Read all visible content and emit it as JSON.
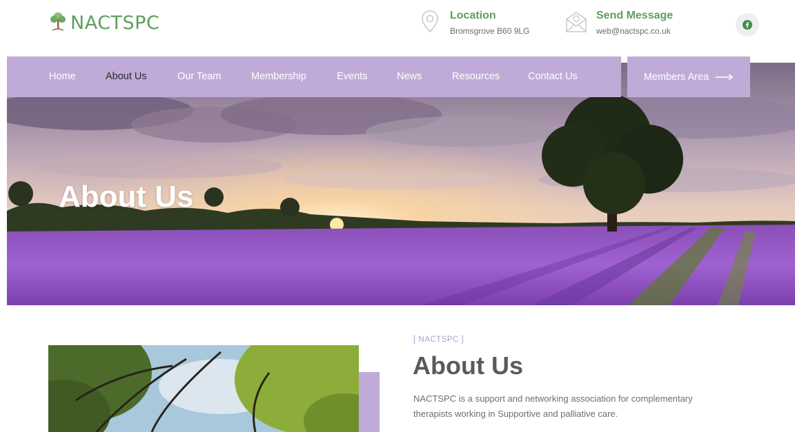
{
  "brand": {
    "name": "NACTSPC"
  },
  "header": {
    "location": {
      "title": "Location",
      "detail": "Bromsgrove B60 9LG"
    },
    "message": {
      "title": "Send Message",
      "detail": "web@nactspc.co.uk"
    },
    "social_icon": "facebook-icon"
  },
  "nav": {
    "items": [
      {
        "label": "Home"
      },
      {
        "label": "About Us",
        "active": true
      },
      {
        "label": "Our Team"
      },
      {
        "label": "Membership"
      },
      {
        "label": "Events"
      },
      {
        "label": "News"
      },
      {
        "label": "Resources"
      },
      {
        "label": "Contact Us"
      }
    ],
    "members_area": "Members Area"
  },
  "hero": {
    "title": "About Us"
  },
  "about": {
    "tag": "[ NACTSPC ]",
    "title": "About Us",
    "text": "NACTSPC is a support and networking association for complementary therapists working in Supportive and palliative care."
  },
  "colors": {
    "brand_green": "#5e9f5c",
    "nav_lavender": "#c0abd8",
    "heading_gray": "#5a5a5a"
  }
}
